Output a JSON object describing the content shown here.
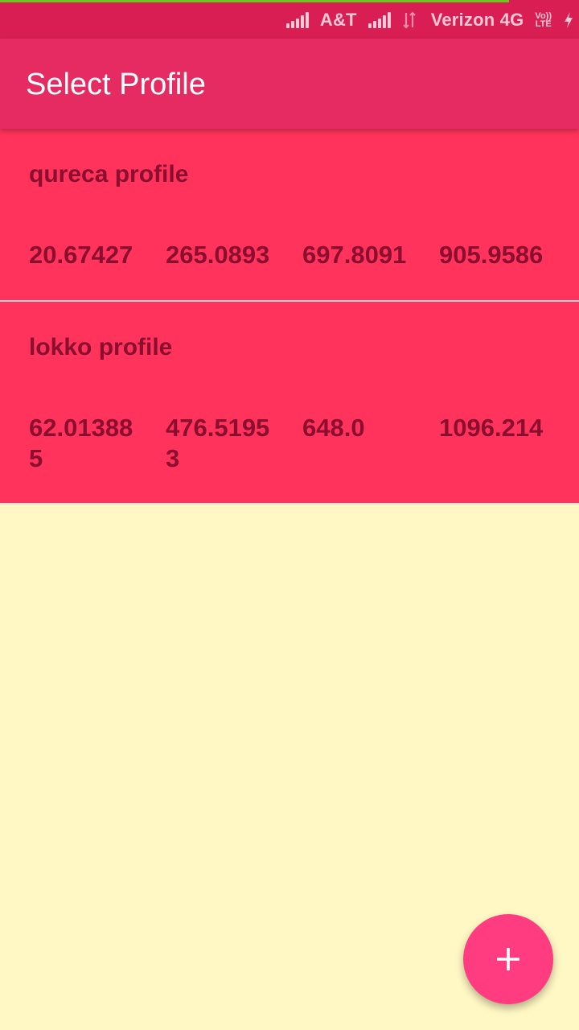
{
  "status_bar": {
    "carrier_1": "A&T",
    "carrier_2": "Verizon 4G",
    "volte_top": "Vo))",
    "volte_bottom": "LTE",
    "signal_1_icon": "signal-bars-icon",
    "signal_2_icon": "signal-bars-icon",
    "data_icon": "data-arrows-icon",
    "charging_icon": "charging-bolt-icon"
  },
  "app_bar": {
    "title": "Select Profile"
  },
  "profiles": [
    {
      "name": "qureca profile",
      "values": [
        "20.67427",
        "265.0893",
        "697.8091",
        "905.9586"
      ]
    },
    {
      "name": "lokko profile",
      "values": [
        "62.013885",
        "476.51953",
        "648.0",
        "1096.214"
      ]
    }
  ],
  "fab": {
    "icon": "plus-icon"
  },
  "colors": {
    "status_bar": "#D81E52",
    "app_bar": "#E52B62",
    "card": "#FF335C",
    "card_text": "#8A0E2E",
    "background": "#FFF8C4",
    "fab": "#FF3C7F",
    "progress": "#6CC61E"
  }
}
